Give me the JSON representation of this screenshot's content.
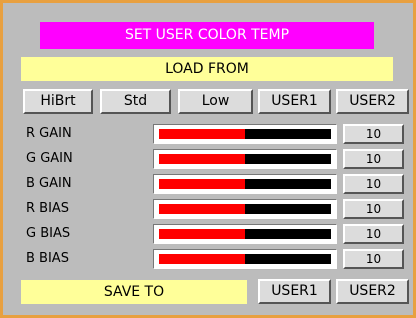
{
  "title": "SET USER COLOR TEMP",
  "load_from": {
    "label": "LOAD FROM",
    "buttons": [
      "HiBrt",
      "Std",
      "Low",
      "USER1",
      "USER2"
    ]
  },
  "adjustments": [
    {
      "label": "R GAIN",
      "value": "10",
      "level": 0.5
    },
    {
      "label": "G GAIN",
      "value": "10",
      "level": 0.5
    },
    {
      "label": "B GAIN",
      "value": "10",
      "level": 0.5
    },
    {
      "label": "R BIAS",
      "value": "10",
      "level": 0.5
    },
    {
      "label": "G BIAS",
      "value": "10",
      "level": 0.5
    },
    {
      "label": "B BIAS",
      "value": "10",
      "level": 0.5
    }
  ],
  "save_to": {
    "label": "SAVE TO",
    "buttons": [
      "USER1",
      "USER2"
    ]
  },
  "colors": {
    "title_bg": "#ff00ff",
    "label_bg": "#ffff99",
    "panel_bg": "#bcbcbc",
    "border": "#e8a040",
    "slider_fill": "#ff0000",
    "slider_track": "#000000"
  }
}
